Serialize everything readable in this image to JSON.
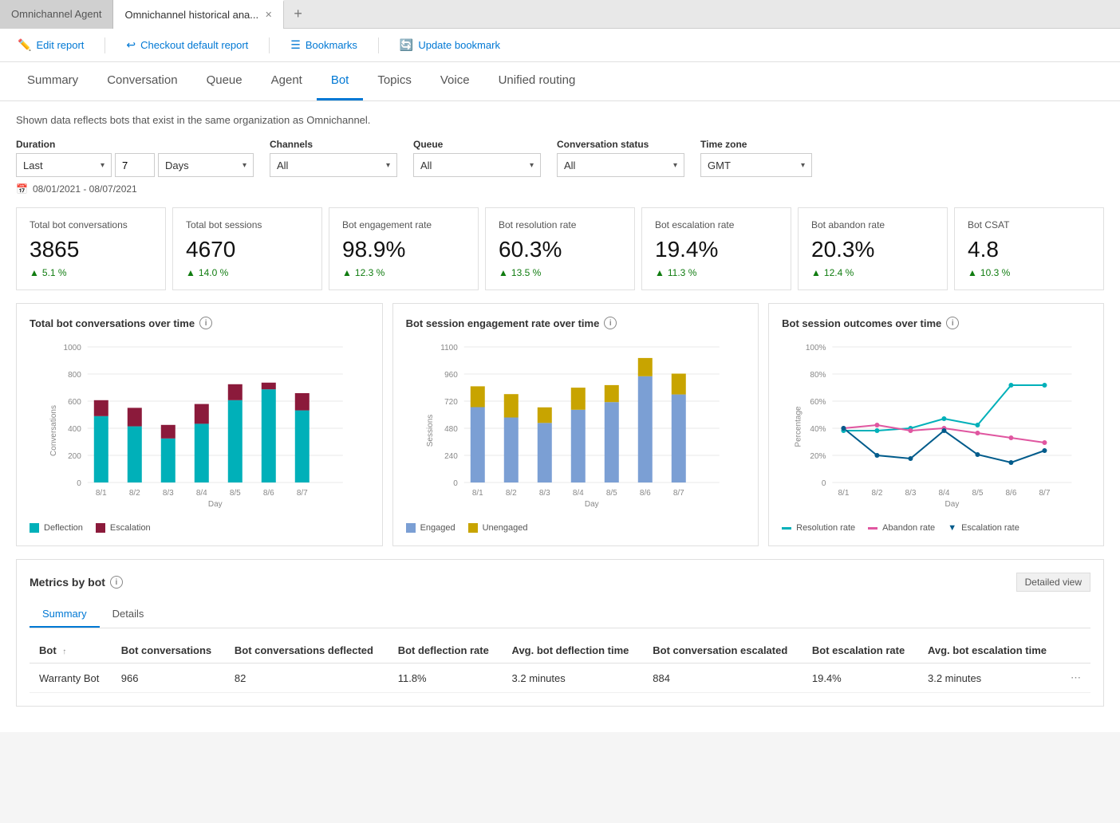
{
  "browser": {
    "tab_inactive_label": "Omnichannel Agent",
    "tab_active_label": "Omnichannel historical ana...",
    "tab_add_label": "+"
  },
  "toolbar": {
    "edit_report": "Edit report",
    "checkout": "Checkout default report",
    "bookmarks": "Bookmarks",
    "update_bookmark": "Update bookmark"
  },
  "nav": {
    "tabs": [
      "Summary",
      "Conversation",
      "Queue",
      "Agent",
      "Bot",
      "Topics",
      "Voice",
      "Unified routing"
    ],
    "active": "Bot"
  },
  "data_note": "Shown data reflects bots that exist in the same organization as Omnichannel.",
  "filters": {
    "duration_label": "Duration",
    "duration_type": "Last",
    "duration_value": "7",
    "duration_unit": "Days",
    "channels_label": "Channels",
    "channels_value": "All",
    "queue_label": "Queue",
    "queue_value": "All",
    "conv_status_label": "Conversation status",
    "conv_status_value": "All",
    "timezone_label": "Time zone",
    "timezone_value": "GMT",
    "date_range": "08/01/2021 - 08/07/2021"
  },
  "kpis": [
    {
      "title": "Total bot conversations",
      "value": "3865",
      "change": "5.1 %",
      "up": true
    },
    {
      "title": "Total bot sessions",
      "value": "4670",
      "change": "14.0 %",
      "up": true
    },
    {
      "title": "Bot engagement rate",
      "value": "98.9%",
      "change": "12.3 %",
      "up": true
    },
    {
      "title": "Bot resolution rate",
      "value": "60.3%",
      "change": "13.5 %",
      "up": true
    },
    {
      "title": "Bot escalation rate",
      "value": "19.4%",
      "change": "11.3 %",
      "up": true
    },
    {
      "title": "Bot abandon rate",
      "value": "20.3%",
      "change": "12.4 %",
      "up": true
    },
    {
      "title": "Bot CSAT",
      "value": "4.8",
      "change": "10.3 %",
      "up": true
    }
  ],
  "charts": {
    "chart1": {
      "title": "Total bot conversations over time",
      "y_label": "Conversations",
      "x_label": "Day",
      "y_ticks": [
        "0",
        "200",
        "400",
        "600",
        "800",
        "1000"
      ],
      "x_ticks": [
        "8/1",
        "8/2",
        "8/3",
        "8/4",
        "8/5",
        "8/6",
        "8/7"
      ],
      "legend": [
        {
          "label": "Deflection",
          "color": "teal"
        },
        {
          "label": "Escalation",
          "color": "maroon"
        }
      ],
      "bars": [
        {
          "deflection": 540,
          "escalation": 130
        },
        {
          "deflection": 460,
          "escalation": 150
        },
        {
          "deflection": 360,
          "escalation": 110
        },
        {
          "deflection": 480,
          "escalation": 160
        },
        {
          "deflection": 680,
          "escalation": 130
        },
        {
          "deflection": 760,
          "escalation": 55
        },
        {
          "deflection": 580,
          "escalation": 140
        }
      ]
    },
    "chart2": {
      "title": "Bot session engagement rate over time",
      "y_label": "Sessions",
      "x_label": "Day",
      "y_ticks": [
        "0",
        "240",
        "480",
        "720",
        "960",
        "1100"
      ],
      "x_ticks": [
        "8/1",
        "8/2",
        "8/3",
        "8/4",
        "8/5",
        "8/6",
        "8/7"
      ],
      "legend": [
        {
          "label": "Engaged",
          "color": "blue"
        },
        {
          "label": "Unengaged",
          "color": "gold"
        }
      ],
      "bars": [
        {
          "engaged": 580,
          "unengaged": 160
        },
        {
          "engaged": 500,
          "unengaged": 180
        },
        {
          "engaged": 460,
          "unengaged": 120
        },
        {
          "engaged": 560,
          "unengaged": 170
        },
        {
          "engaged": 620,
          "unengaged": 130
        },
        {
          "engaged": 820,
          "unengaged": 140
        },
        {
          "engaged": 680,
          "unengaged": 160
        }
      ]
    },
    "chart3": {
      "title": "Bot session outcomes over time",
      "y_label": "Percentage",
      "x_label": "Day",
      "y_ticks": [
        "0",
        "20%",
        "40%",
        "60%",
        "80%",
        "100%"
      ],
      "x_ticks": [
        "8/1",
        "8/2",
        "8/3",
        "8/4",
        "8/5",
        "8/6",
        "8/7"
      ],
      "legend": [
        {
          "label": "Resolution rate",
          "color": "#00b0b9"
        },
        {
          "label": "Abandon rate",
          "color": "#e056a0"
        },
        {
          "label": "Escalation rate",
          "color": "#005b8b"
        }
      ]
    }
  },
  "metrics": {
    "title": "Metrics by bot",
    "tabs": [
      "Summary",
      "Details"
    ],
    "active_tab": "Summary",
    "detailed_view_label": "Detailed view",
    "columns": [
      "Bot",
      "Bot conversations",
      "Bot conversations deflected",
      "Bot deflection rate",
      "Avg. bot deflection time",
      "Bot conversation escalated",
      "Bot escalation rate",
      "Avg. bot escalation time",
      ""
    ],
    "rows": [
      {
        "bot": "Warranty Bot",
        "conversations": "966",
        "deflected": "82",
        "deflection_rate": "11.8%",
        "avg_deflection": "3.2 minutes",
        "escalated": "884",
        "escalation_rate": "19.4%",
        "avg_escalation": "3.2 minutes"
      }
    ]
  }
}
